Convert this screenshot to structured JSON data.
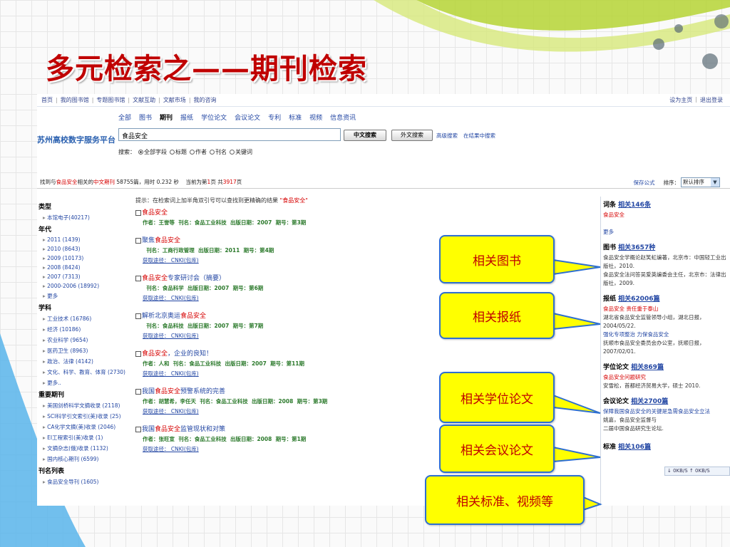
{
  "slide": {
    "title": "多元检索之——期刊检索"
  },
  "topnav": {
    "left": [
      "首页",
      "我的图书馆",
      "专题图书馆",
      "文献互助",
      "文献市场",
      "我的咨询"
    ],
    "right": [
      "设为主页",
      "退出登录"
    ]
  },
  "platform": {
    "logo": "苏州高校数字服务平台",
    "categories": [
      "全部",
      "图书",
      "期刊",
      "报纸",
      "学位论文",
      "会议论文",
      "专利",
      "标准",
      "视频",
      "信息资讯"
    ],
    "active_category": "期刊",
    "search_value": "食品安全",
    "btn_cn": "中文搜索",
    "btn_en": "外文搜索",
    "adv_links": [
      "高级搜索",
      "在结果中搜索"
    ],
    "fields_label": "搜索：",
    "fields": [
      "全部字段",
      "标题",
      "作者",
      "刊名",
      "关键词"
    ],
    "selected_field": "全部字段"
  },
  "resultbar": {
    "p1": "找到与",
    "keyword": "食品安全",
    "p2": "相关的",
    "type": "中文期刊",
    "count": "58755",
    "p3": "篇，用时 0.232 秒    当前为第",
    "page": "1",
    "p4": "页 共",
    "total_pages": "3917",
    "p5": "页",
    "save_formula": "保存公式",
    "sort_label": "排序：",
    "sort_value": "默认排序"
  },
  "facets": [
    {
      "title": "类型",
      "items": [
        "本馆电子(40217)"
      ]
    },
    {
      "title": "年代",
      "items": [
        "2011 (1439)",
        "2010 (8643)",
        "2009 (10173)",
        "2008 (8424)",
        "2007 (7313)",
        "2000-2006 (18992)",
        "更多"
      ]
    },
    {
      "title": "学科",
      "items": [
        "工业技术 (16786)",
        "经济 (10186)",
        "农业科学 (9654)",
        "医药卫生 (8963)",
        "政治、法律 (4142)",
        "文化、科学、教育、体育 (2730)",
        "更多.."
      ]
    },
    {
      "title": "重要期刊",
      "items": [
        "美国剑桥科学文摘收录 (2118)",
        "SCI科学引文索引(美)收录 (25)",
        "CA化学文摘(美)收录 (2046)",
        "EI工程索引(美)收录 (1)",
        "文摘杂志(俄)收录 (1132)",
        "国内核心期刊 (6599)"
      ]
    },
    {
      "title": "刊名列表",
      "items": [
        "食品安全导刊 (1605)"
      ]
    }
  ],
  "hint": {
    "text": "提示：在检索词上加半角双引号可以查找到更精确的结果",
    "example": "\"食品安全\""
  },
  "records": [
    {
      "pre": "",
      "hl": "食品安全",
      "post": "",
      "author": "作者：王誉等",
      "journal": "刊名：食品工业科技",
      "date": "出版日期：2007",
      "issue": "期号：第3期",
      "get": ""
    },
    {
      "pre": "聚焦",
      "hl": "食品安全",
      "post": "",
      "author": "",
      "journal": "刊名：工商行政管理",
      "date": "出版日期：2011",
      "issue": "期号：第4期",
      "get": "获取途径： CNKI(包库)"
    },
    {
      "pre": "",
      "hl": "食品安全",
      "post": "专家研讨会（摘要）",
      "author": "",
      "journal": "刊名：食品科学",
      "date": "出版日期：2007",
      "issue": "期号：第6期",
      "get": "获取途径： CNKI(包库)"
    },
    {
      "pre": "解析北京奥运",
      "hl": "食品安全",
      "post": "",
      "author": "",
      "journal": "刊名：食品科技",
      "date": "出版日期：2007",
      "issue": "期号：第7期",
      "get": "获取途径： CNKI(包库)"
    },
    {
      "pre": "",
      "hl": "食品安全",
      "post": "，企业的良知！",
      "author": "作者：人和",
      "journal": "刊名：食品工业科技",
      "date": "出版日期：2007",
      "issue": "期号：第11期",
      "get": "获取途径： CNKI(包库)"
    },
    {
      "pre": "我国",
      "hl": "食品安全",
      "post": "预警系统的完善",
      "author": "作者：胡慧希，李任天",
      "journal": "刊名：食品工业科技",
      "date": "出版日期：2008",
      "issue": "期号：第3期",
      "get": "获取途径： CNKI(包库)"
    },
    {
      "pre": "我国",
      "hl": "食品安全",
      "post": "监管现状和对策",
      "author": "作者：张旺宣",
      "journal": "刊名：食品工业科技",
      "date": "出版日期：2008",
      "issue": "期号：第1期",
      "get": "获取途径： CNKI(包库)"
    }
  ],
  "right": {
    "cidian": {
      "h": "词条",
      "cnt": "相关146条",
      "lines": [
        "食品安全",
        "",
        "更多"
      ]
    },
    "tushu": {
      "h": "图书",
      "cnt": "相关3657种",
      "lines": [
        "食品安全学概论赵笑虹编著，北京市：中国轻工业出版社，2010.",
        "食品安全法问答吴爱英编委会主任，北京市：法律出版社，2009."
      ]
    },
    "baozhi": {
      "h": "报纸",
      "cnt": "相关62006篇",
      "lines": [
        "食品安全 责任重于泰山",
        "湖北省食品安全监管领导小组，湖北日报，2004/05/22.",
        "强化专项整治 力保食品安全",
        "抚顺市食品安全委员会办公室，抚顺日报，2007/02/01."
      ]
    },
    "xuewei": {
      "h": "学位论文",
      "cnt": "相关869篇",
      "lines": [
        "食品安全问题研究",
        "安雪松，首都经济贸易大学，硕士 2010."
      ]
    },
    "huiyi": {
      "h": "会议论文",
      "cnt": "相关2700篇",
      "lines": [
        "保障我国食品安全的关键是急需食品安全立法",
        "姚嘉，食品安全监督与",
        "二届中国食品研究生论坛."
      ]
    },
    "biaozhun": {
      "h": "标准",
      "cnt": "相关106篇"
    },
    "status": "↓ 0KB/S  ↑ 0KB/S"
  },
  "callouts": [
    "相关图书",
    "相关报纸",
    "相关学位论文",
    "相关会议论文",
    "相关标准、视频等"
  ]
}
